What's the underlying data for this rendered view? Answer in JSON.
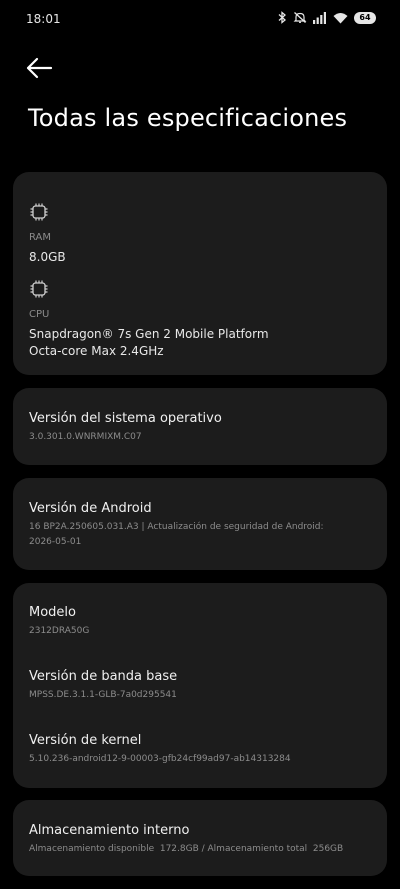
{
  "status_bar": {
    "time": "18:01",
    "battery": "64",
    "icons": [
      "bluetooth-icon",
      "mute-icon",
      "signal-icon",
      "wifi-icon",
      "battery-icon"
    ]
  },
  "header": {
    "back_icon": "arrow-left-icon",
    "title": "Todas las especificaciones"
  },
  "hardware": {
    "ram": {
      "icon": "chip-icon",
      "label": "RAM",
      "value": "8.0GB"
    },
    "cpu": {
      "icon": "chip-icon",
      "label": "CPU",
      "value_line1": "Snapdragon® 7s Gen 2 Mobile Platform",
      "value_line2": "Octa-core Max 2.4GHz"
    }
  },
  "os": {
    "title": "Versión del sistema operativo",
    "value": "3.0.301.0.WNRMIXM.C07"
  },
  "android": {
    "title": "Versión de Android",
    "value_line1": "16 BP2A.250605.031.A3 | Actualización de seguridad de Android:",
    "value_line2": "2026-05-01"
  },
  "device": {
    "model_title": "Modelo",
    "model_value": "2312DRA50G",
    "baseband_title": "Versión de banda base",
    "baseband_value": "MPSS.DE.3.1.1-GLB-7a0d295541",
    "kernel_title": "Versión de kernel",
    "kernel_value": "5.10.236-android12-9-00003-gfb24cf99ad97-ab14313284"
  },
  "storage": {
    "title": "Almacenamiento interno",
    "value": "Almacenamiento disponible  172.8GB / Almacenamiento total  256GB"
  },
  "colors": {
    "background": "#000000",
    "card": "#1c1c1c",
    "primary_text": "#ffffff",
    "secondary_text": "#8c8c8c"
  }
}
